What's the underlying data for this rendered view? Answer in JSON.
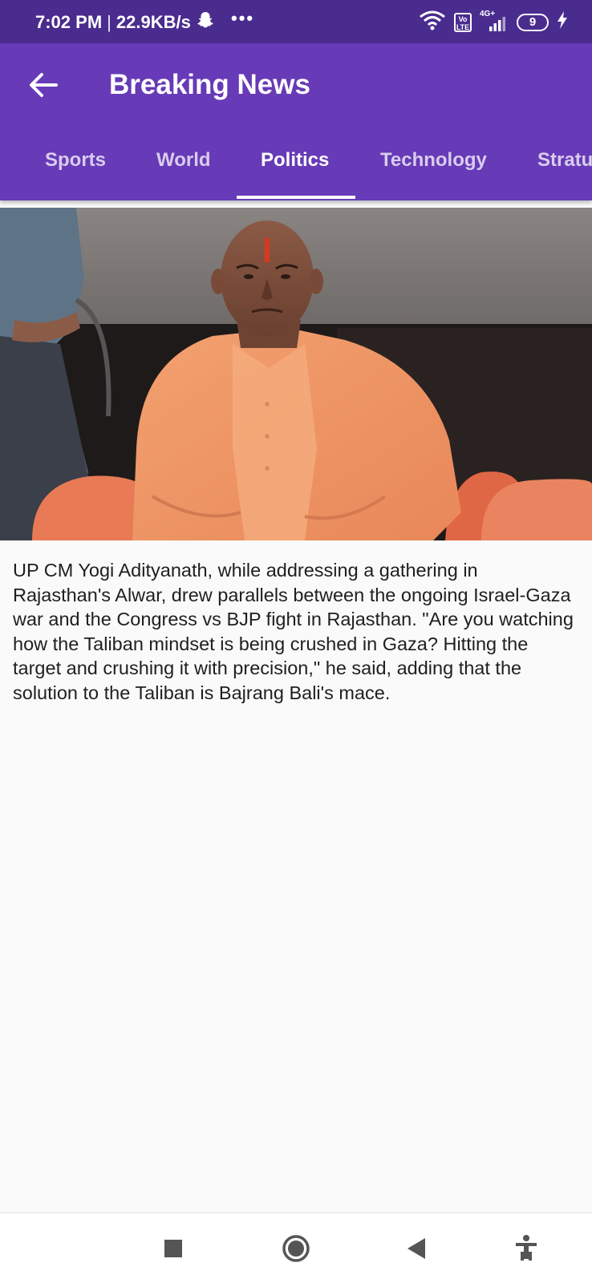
{
  "status_bar": {
    "time": "7:02 PM",
    "separator": "|",
    "net_speed": "22.9KB/s",
    "more_dots": "•••",
    "volte": "Vo LTE",
    "network_type": "4G+",
    "battery_level": "9",
    "icons": [
      "snapchat-icon",
      "wifi-icon",
      "volte-icon",
      "signal-icon",
      "battery-icon",
      "charging-icon"
    ]
  },
  "app_bar": {
    "title": "Breaking News",
    "back_icon": "arrow-back-icon",
    "background_color": "#673ab7"
  },
  "tabs": [
    {
      "label": "Sports",
      "active": false
    },
    {
      "label": "World",
      "active": false
    },
    {
      "label": "Politics",
      "active": true
    },
    {
      "label": "Technology",
      "active": false
    },
    {
      "label": "Stratu",
      "active": false
    }
  ],
  "article": {
    "text": "UP CM Yogi Adityanath, while addressing a gathering in Rajasthan's Alwar, drew parallels between the ongoing Israel-Gaza war and the Congress vs BJP fight in Rajasthan. \"Are you watching how the Taliban mindset is being crushed in Gaza? Hitting the target and crushing it with precision,\" he said, adding that the solution to the Taliban is Bajrang Bali's mace."
  },
  "nav_bar": {
    "icons": [
      "recents-square-icon",
      "home-circle-icon",
      "back-triangle-icon",
      "accessibility-icon"
    ]
  },
  "colors": {
    "status_bar": "#4a2c8f",
    "app_bar": "#673ab7",
    "tab_inactive": "#d8cdee",
    "tab_active": "#ffffff",
    "body_background": "#fafafa"
  }
}
